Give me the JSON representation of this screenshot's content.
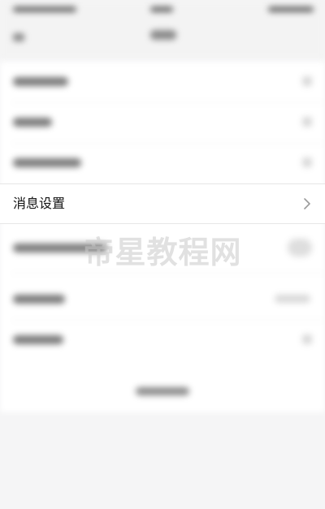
{
  "focused_row": {
    "label": "消息设置",
    "icon": "chevron-right-icon"
  },
  "watermark": {
    "text": "帝星教程网"
  },
  "colors": {
    "background": "#f5f5f6",
    "card": "#ffffff",
    "text": "#111111",
    "chevron": "#9a9a9a",
    "divider": "#e6e6e6"
  }
}
